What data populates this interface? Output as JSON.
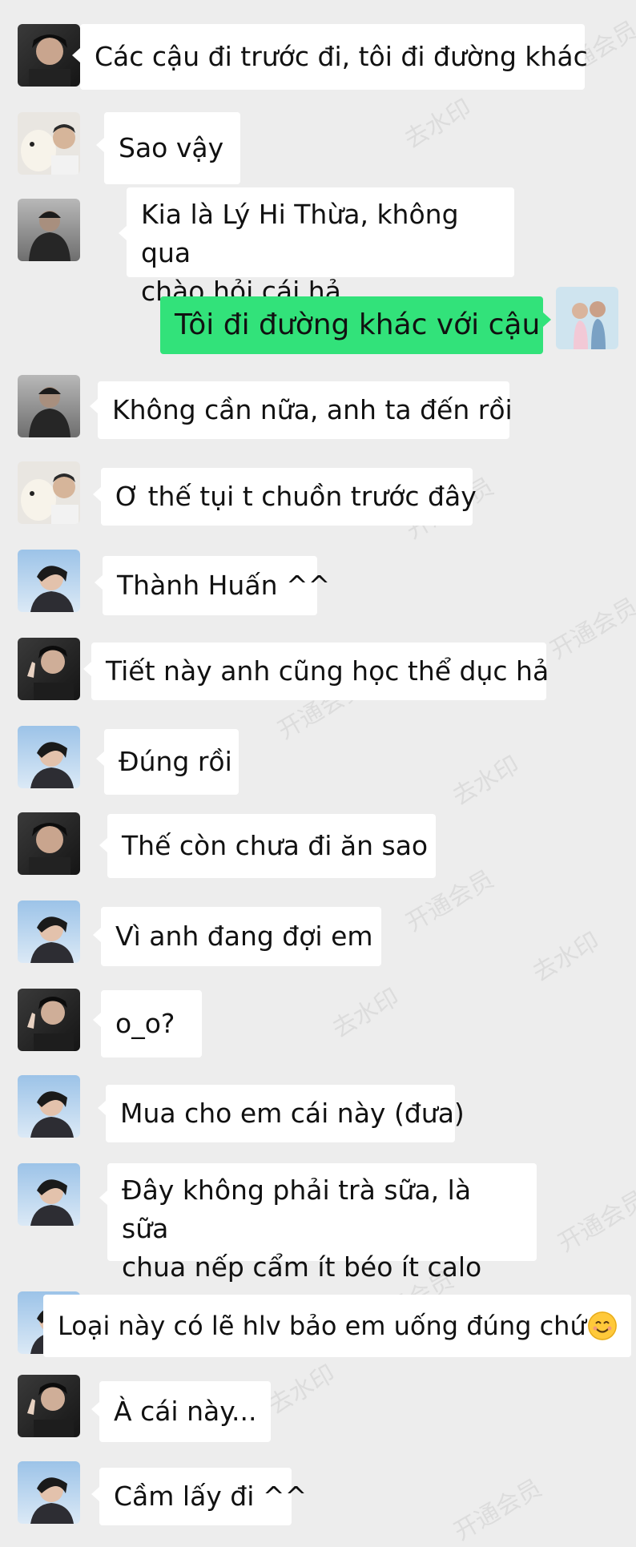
{
  "colors": {
    "background": "#ededed",
    "incoming_bubble": "#ffffff",
    "outgoing_bubble": "#32e27a"
  },
  "messages": [
    {
      "sender": "other",
      "avatar": "avatar-dark-portrait",
      "text": "Các cậu đi trước đi, tôi đi đường khác"
    },
    {
      "sender": "other",
      "avatar": "avatar-with-dog",
      "text": "Sao vậy"
    },
    {
      "sender": "other",
      "avatar": "avatar-dark-hoodie",
      "lines": [
        "Kia là Lý Hi Thừa, không qua",
        "chào hỏi cái hả"
      ]
    },
    {
      "sender": "me",
      "avatar": "avatar-couple-photo",
      "text": "Tôi đi đường khác với cậu"
    },
    {
      "sender": "other",
      "avatar": "avatar-dark-hoodie",
      "text": "Không cần nữa, anh ta đến rồi"
    },
    {
      "sender": "other",
      "avatar": "avatar-with-dog",
      "text": "Ơ thế tụi t chuồn trước đây"
    },
    {
      "sender": "other",
      "avatar": "avatar-sky-portrait",
      "text": "Thành Huấn ^^"
    },
    {
      "sender": "other",
      "avatar": "avatar-peace-sign",
      "text": "Tiết này anh cũng học thể dục hả"
    },
    {
      "sender": "other",
      "avatar": "avatar-sky-portrait",
      "text": "Đúng rồi"
    },
    {
      "sender": "other",
      "avatar": "avatar-dark-portrait",
      "text": "Thế còn chưa đi ăn sao"
    },
    {
      "sender": "other",
      "avatar": "avatar-sky-portrait",
      "text": "Vì anh đang đợi em"
    },
    {
      "sender": "other",
      "avatar": "avatar-peace-sign",
      "text": "o_o?"
    },
    {
      "sender": "other",
      "avatar": "avatar-sky-portrait",
      "text": "Mua cho em cái này (đưa)"
    },
    {
      "sender": "other",
      "avatar": "avatar-sky-portrait",
      "lines": [
        "Đây không phải trà sữa, là sữa",
        "chua nếp cẩm ít béo ít calo"
      ]
    },
    {
      "sender": "other",
      "avatar": "avatar-sky-portrait",
      "text": "Loại này có lẽ hlv bảo em uống đúng chứ",
      "emoji": "smiling-face-icon"
    },
    {
      "sender": "other",
      "avatar": "avatar-peace-sign",
      "text": "À cái này..."
    },
    {
      "sender": "other",
      "avatar": "avatar-sky-portrait",
      "text": "Cầm lấy đi ^^"
    }
  ],
  "watermarks": [
    "去水印",
    "开通会员"
  ]
}
